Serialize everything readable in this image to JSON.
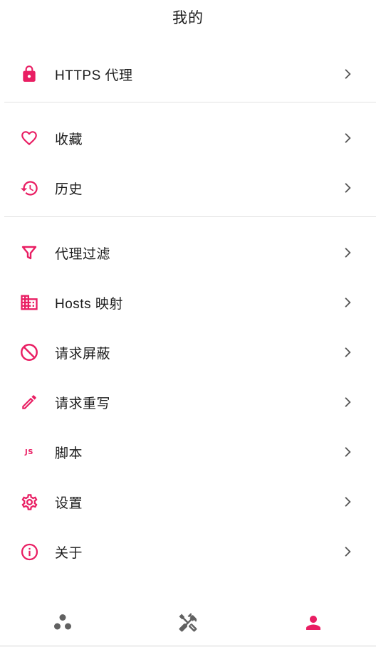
{
  "header": {
    "title": "我的"
  },
  "colors": {
    "accent": "#e91e63",
    "icon_gray": "#616161",
    "divider": "#e3e3e3"
  },
  "menu": [
    {
      "id": "https-proxy",
      "label": "HTTPS 代理",
      "icon": "lock-icon"
    },
    {
      "id": "favorites",
      "label": "收藏",
      "icon": "heart-icon"
    },
    {
      "id": "history",
      "label": "历史",
      "icon": "history-icon"
    },
    {
      "id": "proxy-filter",
      "label": "代理过滤",
      "icon": "filter-icon"
    },
    {
      "id": "hosts-mapping",
      "label": "Hosts 映射",
      "icon": "domain-icon"
    },
    {
      "id": "request-block",
      "label": "请求屏蔽",
      "icon": "block-icon"
    },
    {
      "id": "request-rewrite",
      "label": "请求重写",
      "icon": "pencil-icon"
    },
    {
      "id": "script",
      "label": "脚本",
      "icon": "js-icon"
    },
    {
      "id": "settings",
      "label": "设置",
      "icon": "gear-icon"
    },
    {
      "id": "about",
      "label": "关于",
      "icon": "info-icon"
    }
  ],
  "js_icon_text": "JS",
  "bottom_nav": [
    {
      "id": "workspace",
      "icon": "bubbles-icon",
      "active": false
    },
    {
      "id": "toolbox",
      "icon": "tools-icon",
      "active": false
    },
    {
      "id": "mine",
      "icon": "person-icon",
      "active": true
    }
  ]
}
